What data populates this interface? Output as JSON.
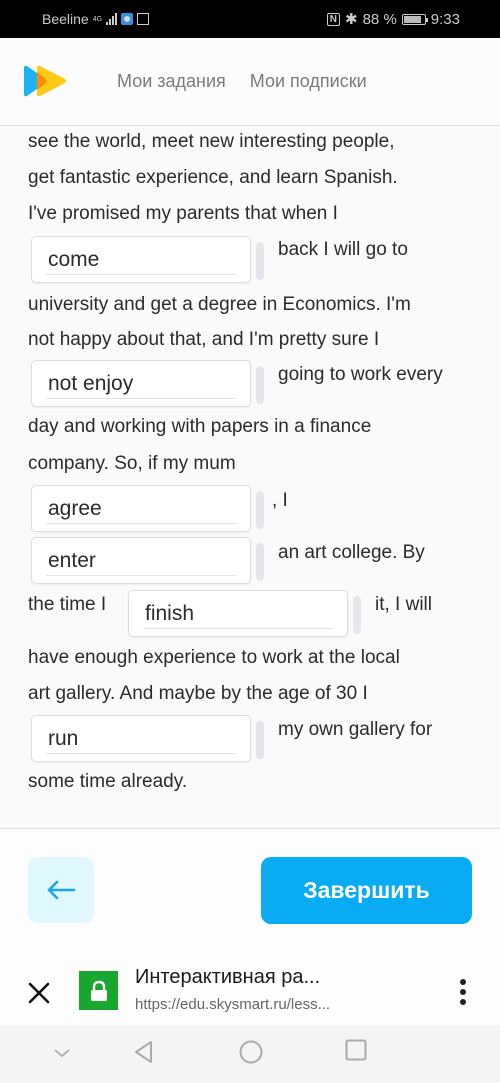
{
  "status_bar": {
    "carrier": "Beeline",
    "network": "4G",
    "battery": "88 %",
    "time": "9:33"
  },
  "header": {
    "logo": "skysmart-logo",
    "nav": [
      {
        "label": "Мои задания"
      },
      {
        "label": "Мои подписки"
      }
    ]
  },
  "exercise": {
    "lines": [
      "see the world, meet new interesting people,",
      "get fantastic experience, and learn Spanish.",
      "I've promised my parents that when I",
      "back I will go to",
      "university and get a degree in Economics. I'm",
      "not happy about that, and I'm pretty sure I",
      "going to work every",
      "day and working with papers in a finance",
      "company. So, if my mum",
      ", I",
      "an art college. By",
      "the time I",
      "it, I will",
      "have enough experience to work at the local",
      "art gallery. And maybe by the age of 30 I",
      "my own gallery for",
      "some time already."
    ],
    "gaps": [
      {
        "value": "come"
      },
      {
        "value": "not enjoy"
      },
      {
        "value": "agree"
      },
      {
        "value": "enter"
      },
      {
        "value": "finish"
      },
      {
        "value": "run"
      }
    ]
  },
  "actions": {
    "back_icon": "arrow-left-icon",
    "finish_label": "Завершить"
  },
  "browser": {
    "page_title": "Интерактивная ра...",
    "url": "https://edu.skysmart.ru/less..."
  },
  "colors": {
    "accent": "#09acf2",
    "back_button_bg": "#e0f8fd",
    "lock_green": "#18a82f"
  }
}
